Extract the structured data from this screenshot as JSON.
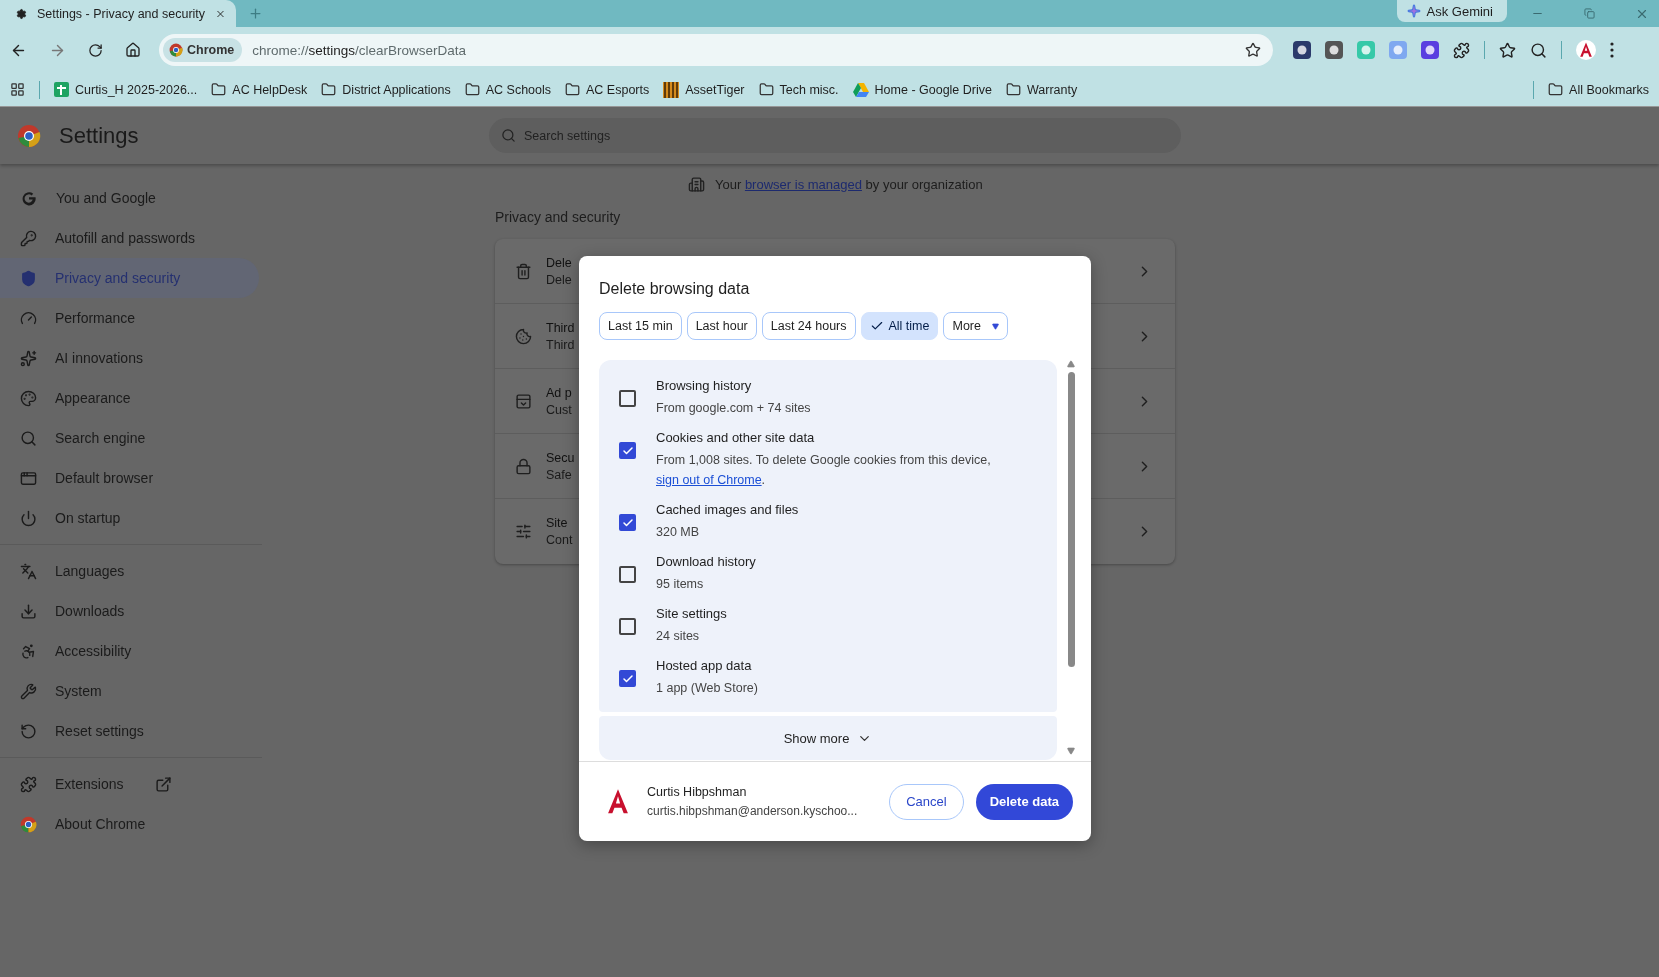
{
  "tab": {
    "title": "Settings - Privacy and security"
  },
  "gemini": {
    "label": "Ask Gemini"
  },
  "address": {
    "chip": "Chrome",
    "scheme": "chrome://",
    "host": "settings",
    "path": "/clearBrowserData"
  },
  "bookmarks": [
    {
      "label": "Curtis_H 2025-2026...",
      "kind": "sheet"
    },
    {
      "label": "AC HelpDesk",
      "kind": "folder"
    },
    {
      "label": "District Applications",
      "kind": "folder"
    },
    {
      "label": "AC Schools",
      "kind": "folder"
    },
    {
      "label": "AC Esports",
      "kind": "folder"
    },
    {
      "label": "AssetTiger",
      "kind": "tiger"
    },
    {
      "label": "Tech misc.",
      "kind": "folder"
    },
    {
      "label": "Home - Google Drive",
      "kind": "drive"
    },
    {
      "label": "Warranty",
      "kind": "folder"
    }
  ],
  "all_bookmarks": "All Bookmarks",
  "settings": {
    "title": "Settings",
    "search_placeholder": "Search settings",
    "managed": {
      "before": "Your ",
      "link": "browser is managed",
      "after": " by your organization"
    },
    "section_title": "Privacy and security",
    "cards": [
      {
        "title": "Dele",
        "subtitle": "Dele"
      },
      {
        "title": "Third",
        "subtitle": "Third"
      },
      {
        "title": "Ad p",
        "subtitle": "Cust"
      },
      {
        "title": "Secu",
        "subtitle": "Safe"
      },
      {
        "title": "Site",
        "subtitle": "Cont"
      }
    ]
  },
  "sidebar": {
    "groups": [
      [
        {
          "label": "You and Google",
          "selected": false
        },
        {
          "label": "Autofill and passwords",
          "selected": false
        },
        {
          "label": "Privacy and security",
          "selected": true
        },
        {
          "label": "Performance",
          "selected": false
        },
        {
          "label": "AI innovations",
          "selected": false
        },
        {
          "label": "Appearance",
          "selected": false
        },
        {
          "label": "Search engine",
          "selected": false
        },
        {
          "label": "Default browser",
          "selected": false
        },
        {
          "label": "On startup",
          "selected": false
        }
      ],
      [
        {
          "label": "Languages",
          "selected": false
        },
        {
          "label": "Downloads",
          "selected": false
        },
        {
          "label": "Accessibility",
          "selected": false
        },
        {
          "label": "System",
          "selected": false
        },
        {
          "label": "Reset settings",
          "selected": false
        }
      ],
      [
        {
          "label": "Extensions",
          "selected": false
        },
        {
          "label": "About Chrome",
          "selected": false
        }
      ]
    ]
  },
  "dialog": {
    "title": "Delete browsing data",
    "time_ranges": [
      {
        "label": "Last 15 min",
        "selected": false
      },
      {
        "label": "Last hour",
        "selected": false
      },
      {
        "label": "Last 24 hours",
        "selected": false
      },
      {
        "label": "All time",
        "selected": true
      },
      {
        "label": "More",
        "selected": false
      }
    ],
    "options": [
      {
        "label": "Browsing history",
        "detail": "From google.com + 74 sites",
        "checked": false
      },
      {
        "label": "Cookies and other site data",
        "detail": "From 1,008 sites. To delete Google cookies from this device, ",
        "link": "sign out of Chrome",
        "detail_after": ".",
        "checked": true
      },
      {
        "label": "Cached images and files",
        "detail": "320 MB",
        "checked": true
      },
      {
        "label": "Download history",
        "detail": "95 items",
        "checked": false
      },
      {
        "label": "Site settings",
        "detail": "24 sites",
        "checked": false
      },
      {
        "label": "Hosted app data",
        "detail": "1 app (Web Store)",
        "checked": true
      }
    ],
    "show_more": "Show more",
    "account": {
      "name": "Curtis Hibpshman",
      "email": "curtis.hibpshman@anderson.kyschoo..."
    },
    "cancel": "Cancel",
    "delete": "Delete data"
  }
}
